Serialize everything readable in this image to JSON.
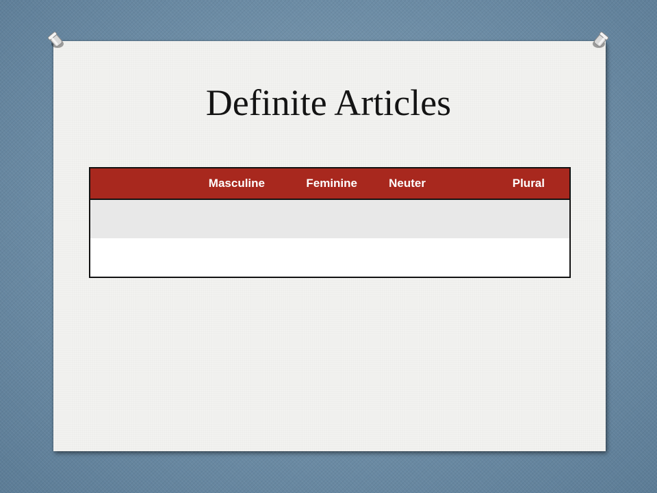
{
  "slide": {
    "title": "Definite Articles"
  },
  "table": {
    "headers": [
      "",
      "Masculine",
      "Feminine",
      "Neuter",
      "Plural"
    ],
    "rows": [
      [
        "",
        "",
        "",
        "",
        ""
      ],
      [
        "",
        "",
        "",
        "",
        ""
      ]
    ]
  },
  "colors": {
    "background": "#6f8fa8",
    "paper": "#f2f2f0",
    "header_fill": "#a8281e",
    "header_text": "#ffffff",
    "row_shaded": "#e8e8e8",
    "row_plain": "#ffffff"
  },
  "icons": [
    "pushpin-icon",
    "pushpin-icon"
  ]
}
